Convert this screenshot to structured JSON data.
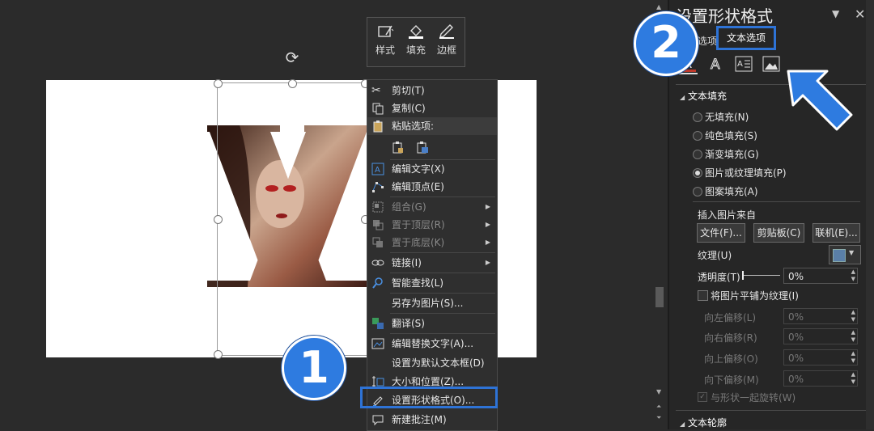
{
  "mini_toolbar": {
    "style_label": "样式",
    "fill_label": "填充",
    "border_label": "边框"
  },
  "slide": {
    "letter": "X"
  },
  "context_menu": {
    "cut": "剪切(T)",
    "copy": "复制(C)",
    "paste_options": "粘贴选项:",
    "edit_text": "编辑文字(X)",
    "edit_points": "编辑顶点(E)",
    "group": "组合(G)",
    "bring_front": "置于顶层(R)",
    "send_back": "置于底层(K)",
    "link": "链接(I)",
    "smart_lookup": "智能查找(L)",
    "save_as_picture": "另存为图片(S)...",
    "translate": "翻译(S)",
    "edit_alt_text": "编辑替换文字(A)...",
    "set_default_textbox": "设置为默认文本框(D)",
    "size_position": "大小和位置(Z)...",
    "format_shape": "设置形状格式(O)...",
    "new_comment": "新建批注(M)"
  },
  "badges": {
    "one": "1",
    "two": "2"
  },
  "panel": {
    "title": "设置形状格式",
    "tab_shape": "选项",
    "tab_text": "文本选项",
    "section_fill": "文本填充",
    "fill_none": "无填充(N)",
    "fill_solid": "纯色填充(S)",
    "fill_gradient": "渐变填充(G)",
    "fill_picture": "图片或纹理填充(P)",
    "fill_pattern": "图案填充(A)",
    "insert_from": "插入图片来自",
    "btn_file": "文件(F)...",
    "btn_clipboard": "剪贴板(C)",
    "btn_online": "联机(E)...",
    "texture": "纹理(U)",
    "transparency": "透明度(T)",
    "transparency_value": "0%",
    "tile": "将图片平铺为纹理(I)",
    "offset_left": "向左偏移(L)",
    "offset_right": "向右偏移(R)",
    "offset_top": "向上偏移(O)",
    "offset_bottom": "向下偏移(M)",
    "offset_left_value": "0%",
    "offset_right_value": "0%",
    "offset_top_value": "0%",
    "offset_bottom_value": "0%",
    "rotate_with_shape": "与形状一起旋转(W)",
    "section_outline": "文本轮廓"
  },
  "colors": {
    "accent": "#2e73d6",
    "badge": "#2e7be0"
  }
}
